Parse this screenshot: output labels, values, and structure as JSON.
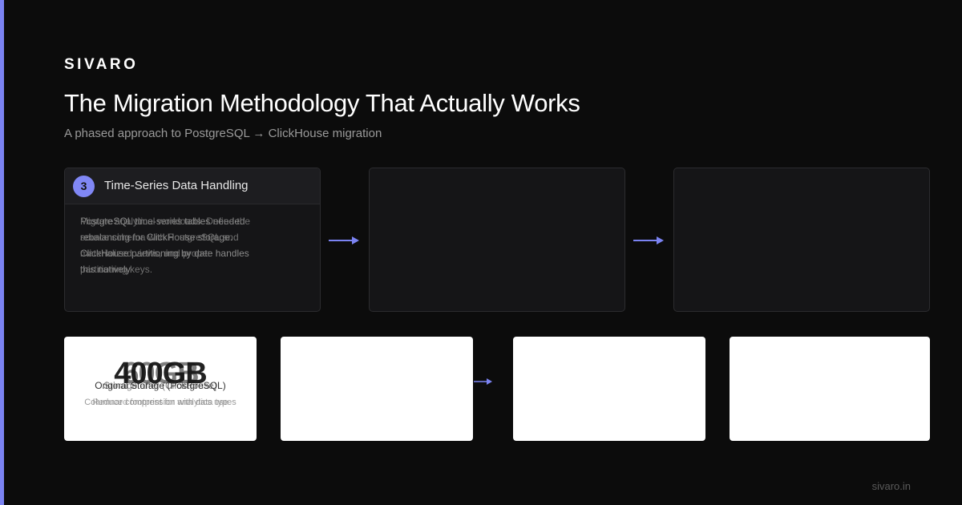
{
  "brand": "SIVARO",
  "title": "The Migration Methodology That Actually Works",
  "subtitle": "A phased approach to PostgreSQL → ClickHouse migration",
  "steps": [
    {
      "number": "3",
      "title": "Time-Series Data Handling",
      "description": "PostgreSQL time-series tables needed rebalancing for ClickHouse storage. ClickHouse partitioning by date handles this natively.",
      "description_overlap": "Migrate analytical workloads. Define the source schema with PostgreSQL and materialized views, and proper partitioning keys."
    },
    {
      "number": "",
      "title": "",
      "description": ""
    },
    {
      "number": "",
      "title": "",
      "description": ""
    }
  ],
  "stats": [
    {
      "value": "400GB",
      "value_overlap": "60GB",
      "label": "Original Storage (PostgreSQL)",
      "label_overlap": "Storage after (ClickHouse)",
      "note": "Columnar compression with data types",
      "note_overlap": "Reduced footprint for analytics use"
    },
    {
      "value": "",
      "label": "",
      "note": ""
    },
    {
      "value": "",
      "label": "",
      "note": ""
    },
    {
      "value": "",
      "label": "",
      "note": ""
    }
  ],
  "footer": "sivaro.in",
  "colors": {
    "accent": "#7b83f2",
    "background": "#0c0c0c",
    "card": "#151517"
  }
}
